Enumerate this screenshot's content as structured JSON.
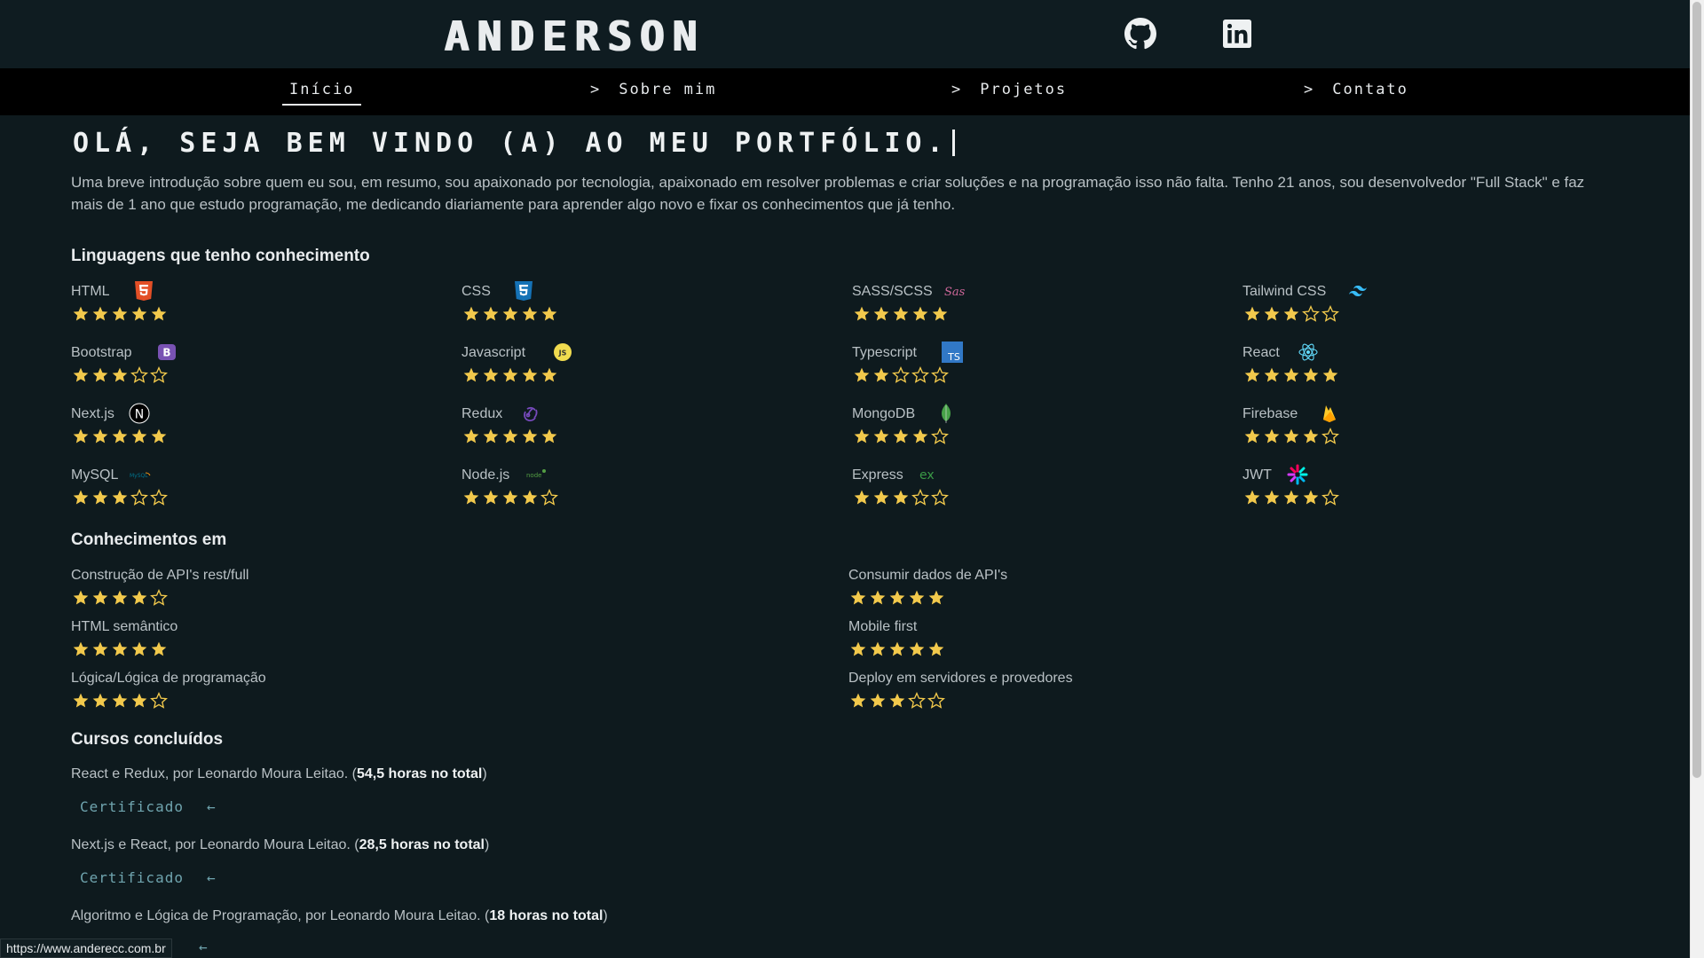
{
  "header": {
    "logo": "ANDERSON",
    "github_icon": "github-icon",
    "linkedin_icon": "linkedin-icon"
  },
  "nav": {
    "items": [
      {
        "label": "Início",
        "active": true
      },
      {
        "label": "Sobre mim",
        "prefix": ">"
      },
      {
        "label": "Projetos",
        "prefix": ">"
      },
      {
        "label": "Contato",
        "prefix": ">"
      }
    ]
  },
  "hero": {
    "title": "OLÁ, SEJA BEM VINDO (A) AO MEU PORTFÓLIO.",
    "intro": "Uma breve introdução sobre quem eu sou, em resumo, sou apaixonado por tecnologia, apaixonado em resolver problemas e criar soluções e na programação isso não falta. Tenho 21 anos, sou desenvolvedor \"Full Stack\" e faz mais de 1 ano que estudo programação, me dedicando diariamente para aprender algo novo e fixar os conhecimentos que já tenho."
  },
  "languages": {
    "title": "Linguagens que tenho conhecimento",
    "items": [
      {
        "name": "HTML",
        "icon": "html5-icon",
        "rating": 5
      },
      {
        "name": "CSS",
        "icon": "css3-icon",
        "rating": 5
      },
      {
        "name": "SASS/SCSS",
        "icon": "sass-icon",
        "rating": 5
      },
      {
        "name": "Tailwind CSS",
        "icon": "tailwind-icon",
        "rating": 3
      },
      {
        "name": "Bootstrap",
        "icon": "bootstrap-icon",
        "rating": 3
      },
      {
        "name": "Javascript",
        "icon": "javascript-icon",
        "rating": 5
      },
      {
        "name": "Typescript",
        "icon": "typescript-icon",
        "rating": 2
      },
      {
        "name": "React",
        "icon": "react-icon",
        "rating": 5
      },
      {
        "name": "Next.js",
        "icon": "nextjs-icon",
        "rating": 5
      },
      {
        "name": "Redux",
        "icon": "redux-icon",
        "rating": 5
      },
      {
        "name": "MongoDB",
        "icon": "mongodb-icon",
        "rating": 4
      },
      {
        "name": "Firebase",
        "icon": "firebase-icon",
        "rating": 4
      },
      {
        "name": "MySQL",
        "icon": "mysql-icon",
        "rating": 3
      },
      {
        "name": "Node.js",
        "icon": "nodejs-icon",
        "rating": 4
      },
      {
        "name": "Express",
        "icon": "express-icon",
        "rating": 3
      },
      {
        "name": "JWT",
        "icon": "jwt-icon",
        "rating": 4
      }
    ]
  },
  "knowledge": {
    "title": "Conhecimentos em",
    "items": [
      {
        "name": "Construção de API's rest/full",
        "rating": 4
      },
      {
        "name": "Consumir dados de API's",
        "rating": 5
      },
      {
        "name": "HTML semântico",
        "rating": 5
      },
      {
        "name": "Mobile first",
        "rating": 5
      },
      {
        "name": "Lógica/Lógica de programação",
        "rating": 4
      },
      {
        "name": "Deploy em servidores e provedores",
        "rating": 3
      }
    ]
  },
  "courses": {
    "title": "Cursos concluídos",
    "items": [
      {
        "text": "React e Redux, por Leonardo Moura Leitao. (",
        "hours": "54,5 horas no total",
        "close": ")",
        "cert": "Certificado"
      },
      {
        "text": "Next.js e React, por Leonardo Moura Leitao. (",
        "hours": "28,5 horas no total",
        "close": ")",
        "cert": "Certificado"
      },
      {
        "text": "Algoritmo e Lógica de Programação, por Leonardo Moura Leitao. (",
        "hours": "18 horas no total",
        "close": ")"
      }
    ],
    "arrow": "←"
  },
  "status_bar": {
    "url": "https://www.anderecc.com.br"
  },
  "colors": {
    "background": "#0e1a1e",
    "star": "#f2c94c",
    "accent": "#6fa4ae"
  }
}
